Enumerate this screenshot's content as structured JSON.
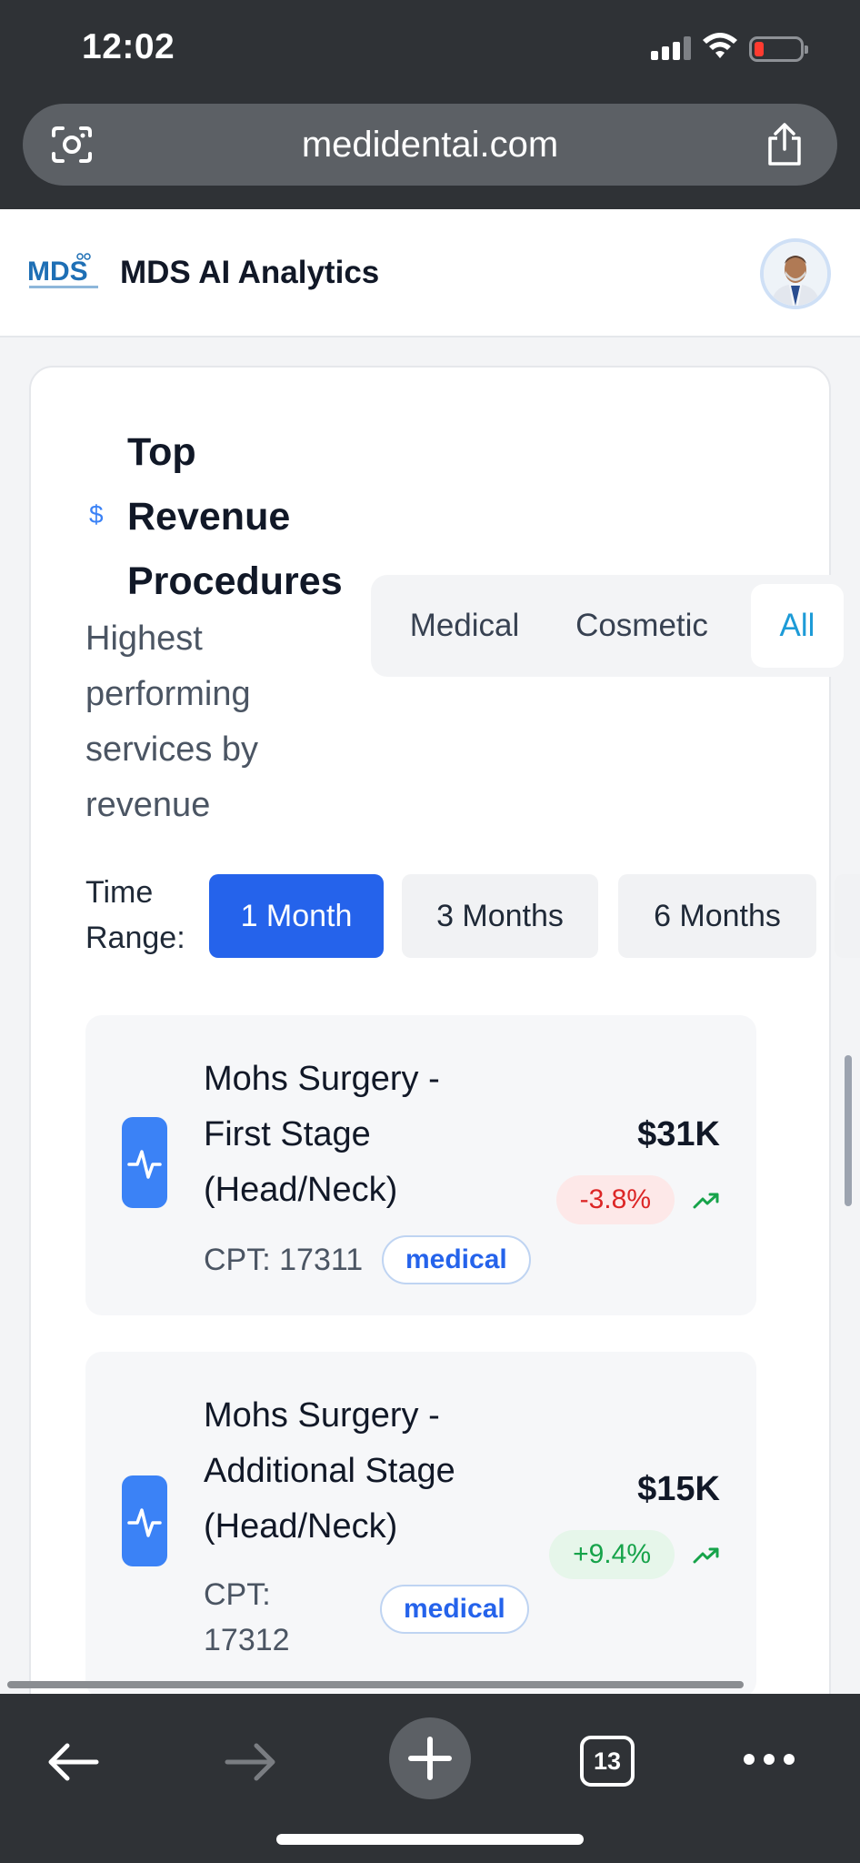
{
  "status_bar": {
    "time": "12:02"
  },
  "browser": {
    "url": "medidentai.com",
    "tab_count": "13"
  },
  "app": {
    "title": "MDS AI Analytics"
  },
  "card": {
    "title": "Top Revenue Procedures",
    "subtitle": "Highest performing services by revenue",
    "category_filters": [
      "Medical",
      "Cosmetic",
      "All"
    ],
    "selected_category": "All",
    "time_range_label": "Time Range:",
    "time_ranges": [
      "1 Month",
      "3 Months",
      "6 Months"
    ],
    "selected_time_range": "1 Month"
  },
  "procedures": [
    {
      "name": "Mohs Surgery - First Stage (Head/Neck)",
      "cpt": "CPT: 17311",
      "category": "medical",
      "amount": "$31K",
      "change": "-3.8%",
      "change_direction": "negative"
    },
    {
      "name": "Mohs Surgery - Additional Stage (Head/Neck)",
      "cpt": "CPT: 17312",
      "category": "medical",
      "amount": "$15K",
      "change": "+9.4%",
      "change_direction": "positive"
    }
  ],
  "colors": {
    "primary": "#2563eb",
    "accent": "#3b82f6",
    "negative": "#dc2626",
    "positive": "#16a34a"
  }
}
